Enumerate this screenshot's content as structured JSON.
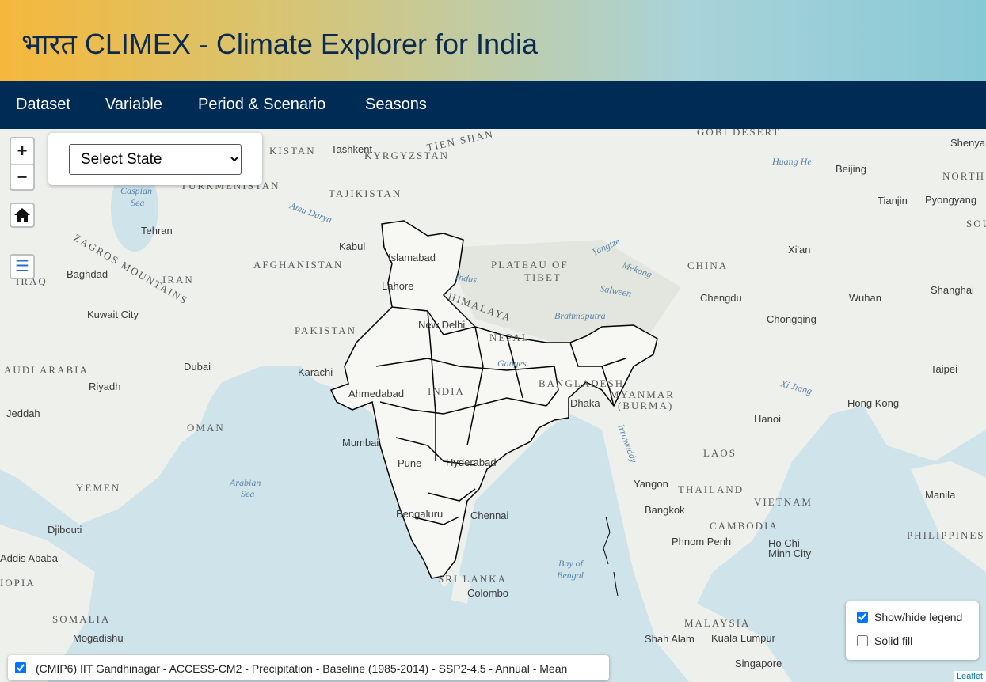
{
  "header": {
    "title": "भारत CLIMEX - Climate Explorer for India"
  },
  "nav": {
    "items": [
      "Dataset",
      "Variable",
      "Period & Scenario",
      "Seasons"
    ]
  },
  "map_controls": {
    "zoom_in": "+",
    "zoom_out": "−",
    "state_select": {
      "selected": "Select State"
    }
  },
  "legend_panel": {
    "show_hide_label": "Show/hide legend",
    "show_hide_checked": true,
    "solid_fill_label": "Solid fill",
    "solid_fill_checked": false
  },
  "layer": {
    "label": "(CMIP6) IIT Gandhinagar - ACCESS-CM2 - Precipitation - Baseline (1985-2014) - SSP2-4.5 - Annual - Mean",
    "checked": true
  },
  "attribution": "Leaflet",
  "map_labels": {
    "countries": [
      "AFGHANISTAN",
      "PAKISTAN",
      "IRAN",
      "CHINA",
      "INDIA",
      "NEPAL",
      "TAJIKISTAN",
      "TURKMENISTAN",
      "KYRGYZSTAN",
      "OMAN",
      "YEMEN",
      "SOMALIA",
      "MYANMAR",
      "(BURMA)",
      "THAILAND",
      "LAOS",
      "VIETNAM",
      "CAMBODIA",
      "MALAYSIA",
      "PHILIPPINES",
      "SRI LANKA",
      "BANGLADESH",
      "AUDI ARABIA",
      "NORTH",
      "SOU",
      "IRAQ",
      "IOPIA",
      "KISTAN"
    ],
    "regions": [
      "PLATEAU OF",
      "TIBET",
      "GOBI DESERT",
      "TIEN SHAN",
      "ZAGROS MOUNTAINS",
      "HIMALAYA"
    ],
    "cities": [
      "Tashkent",
      "Kabul",
      "Islamabad",
      "Lahore",
      "New Delhi",
      "Karachi",
      "Ahmedabad",
      "Mumbai",
      "Pune",
      "Hyderabad",
      "Bengaluru",
      "Chennai",
      "Colombo",
      "Dhaka",
      "Tehran",
      "Baghdad",
      "Kuwait City",
      "Dubai",
      "Riyadh",
      "Jeddah",
      "Djibouti",
      "Addis Ababa",
      "Mogadishu",
      "Beijing",
      "Tianjin",
      "Pyongyang",
      "Shenya",
      "Xi'an",
      "Chengdu",
      "Wuhan",
      "Shanghai",
      "Chongqing",
      "Taipei",
      "Hong Kong",
      "Hanoi",
      "Yangon",
      "Bangkok",
      "Phnom Penh",
      "Ho Chi",
      "Minh City",
      "Manila",
      "Kuala Lumpur",
      "Shah Alam",
      "Singapore"
    ],
    "water": [
      "Caspian",
      "Sea",
      "Arabian",
      "Sea",
      "Bay of",
      "Bengal",
      "Huang He",
      "Amu Darya",
      "Indus",
      "Yangtze",
      "Mekong",
      "Salween",
      "Brahmaputra",
      "Ganges",
      "Xi Jiang",
      "Irrawaddy"
    ]
  },
  "colors": {
    "header_gradient_start": "#f5b83c",
    "header_gradient_end": "#88c9d6",
    "navbar": "#002b55",
    "title_text": "#0c2a4e",
    "land": "#eef0ec",
    "water": "#cfe3ea"
  }
}
